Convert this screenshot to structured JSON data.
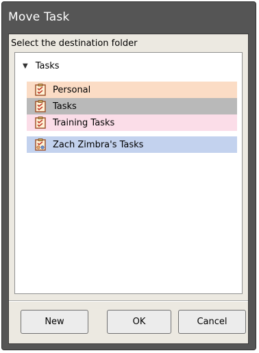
{
  "dialog": {
    "title": "Move Task",
    "instruction": "Select the destination folder"
  },
  "tree": {
    "root_label": "Tasks",
    "root_expanded": true,
    "items": [
      {
        "label": "Personal",
        "icon": "task-list-icon",
        "color": "#fbdcc5"
      },
      {
        "label": "Tasks",
        "icon": "task-list-icon",
        "color": "#b9b9b9",
        "selected": true
      },
      {
        "label": "Training Tasks",
        "icon": "task-list-icon",
        "color": "#fbdde8"
      },
      {
        "label": "Zach Zimbra's Tasks",
        "icon": "shared-task-list-icon",
        "color": "#c3d2ee"
      }
    ]
  },
  "buttons": {
    "new_label": "New",
    "ok_label": "OK",
    "cancel_label": "Cancel"
  }
}
